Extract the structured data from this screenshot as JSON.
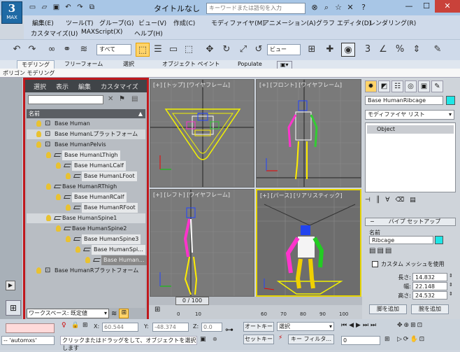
{
  "app": {
    "logo": "MAX",
    "title": "タイトルなし",
    "search_placeholder": "キーワードまたは語句を入力"
  },
  "menus": [
    "編集(E)",
    "ツール(T)",
    "グループ(G)",
    "ビュー(V)",
    "作成(C)",
    "モディファイヤ(M)",
    "アニメーション(A)",
    "グラフ エディタ(D)",
    "レンダリング(R)",
    "カスタマイズ(U)",
    "MAXScript(X)",
    "ヘルプ(H)"
  ],
  "toolbar": {
    "selection_filter": "すべて",
    "ref_coord": "ビュー"
  },
  "ribbon": {
    "tabs": [
      "モデリング",
      "フリーフォーム",
      "選択",
      "オブジェクト ペイント",
      "Populate"
    ],
    "sub": "ポリゴン モデリング"
  },
  "scene_explorer": {
    "menus": [
      "選択",
      "表示",
      "編集",
      "カスタマイズ"
    ],
    "column": "名前",
    "rows": [
      {
        "label": "Base Human"
      },
      {
        "label": "Base HumanLプラットフォーム"
      },
      {
        "label": "Base HumanPelvis"
      },
      {
        "label": "Base HumanLThigh"
      },
      {
        "label": "Base HumanLCalf"
      },
      {
        "label": "Base HumanLFoot"
      },
      {
        "label": "Base HumanRThigh"
      },
      {
        "label": "Base HumanRCalf"
      },
      {
        "label": "Base HumanRFoot"
      },
      {
        "label": "Base HumanSpine1"
      },
      {
        "label": "Base HumanSpine2"
      },
      {
        "label": "Base HumanSpine3"
      },
      {
        "label": "Base HumanSpi..."
      },
      {
        "label": "Base Human..."
      },
      {
        "label": "Base HumanRプラットフォーム"
      }
    ],
    "workspace": "ワークスペース: 既定値"
  },
  "viewports": {
    "top": "[+] [トップ] [ワイヤフレーム]",
    "front": "[+] [フロント] [ワイヤフレーム]",
    "left": "[+] [レフト] [ワイヤフレーム]",
    "persp": "[+] [パース] [リアリスティック]"
  },
  "command_panel": {
    "object_name": "Base HumanRibcage",
    "modifier_list": "モディファイヤ リスト",
    "stack_item": "Object",
    "rollout": "バイプ セットアップ",
    "name_label": "名前",
    "name_value": "Ribcage",
    "custom_mesh": "カスタム メッシュを使用",
    "length_label": "長さ:",
    "length": "14.832",
    "width_label": "幅:",
    "width": "22.148",
    "height_label": "高さ:",
    "height": "24.532",
    "add_leg": "脚を追加",
    "add_arm": "腕を追加"
  },
  "timeline": {
    "frame": "0 / 100",
    "ticks": [
      "0",
      "10",
      "60",
      "70",
      "80",
      "90",
      "100"
    ]
  },
  "status": {
    "x_label": "X:",
    "x": "60.544",
    "y_label": "Y:",
    "y": "-48.374",
    "z_label": "Z:",
    "z": "0.0",
    "autokey": "オートキー",
    "setkey": "セットキー",
    "sel": "選択",
    "keyfilter": "キー フィルタ...",
    "frame": "0",
    "script": "-- 'automxs'",
    "prompt": "クリックまたはドラッグをして、オブジェクトを選択します"
  },
  "colors": {
    "highlight": "#c0181c",
    "active_viewport": "#e6d400",
    "cp_swatch": "#1ee6e6"
  }
}
